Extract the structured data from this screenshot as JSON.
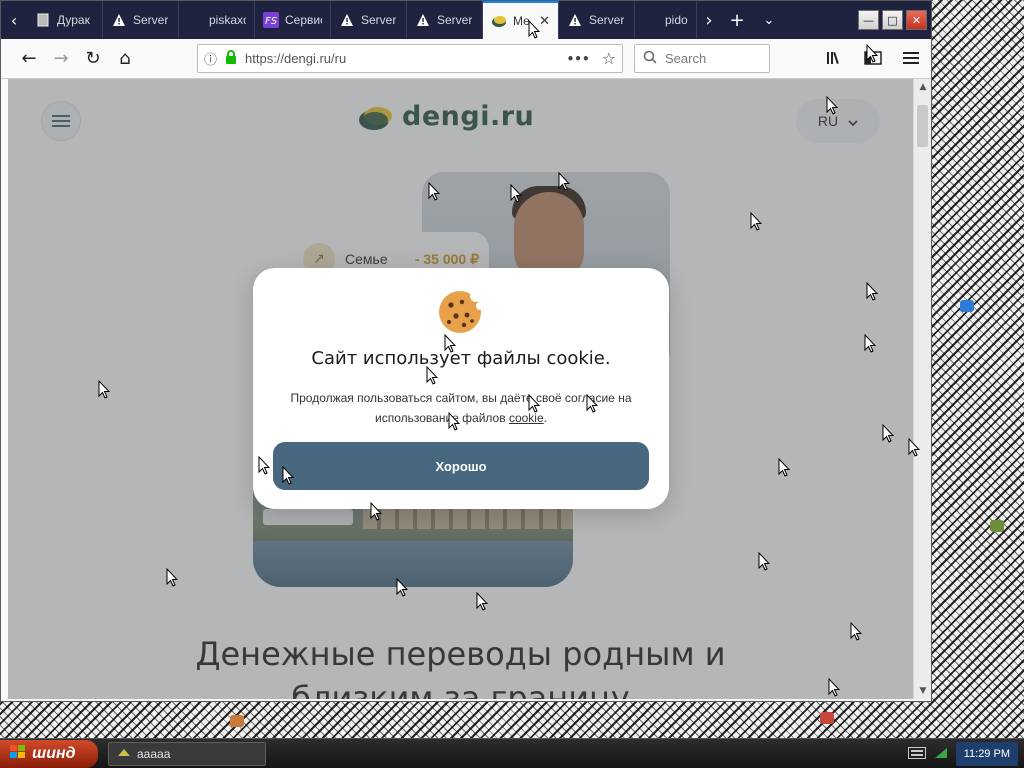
{
  "browser": {
    "tabs": [
      {
        "label": "Дурак",
        "icon": "page-icon"
      },
      {
        "label": "Server",
        "icon": "warning-icon"
      },
      {
        "label": "piskaxo",
        "icon": "blank-icon"
      },
      {
        "label": "Сервис",
        "icon": "fs-icon"
      },
      {
        "label": "Server",
        "icon": "warning-icon"
      },
      {
        "label": "Server",
        "icon": "warning-icon"
      },
      {
        "label": "Ме",
        "icon": "dengi-icon",
        "active": true
      },
      {
        "label": "Server",
        "icon": "warning-icon"
      },
      {
        "label": "pidor",
        "icon": "blank-icon"
      }
    ],
    "url": "https://dengi.ru/ru",
    "search_placeholder": "Search"
  },
  "site": {
    "logo_text": "dengi.ru",
    "language": "RU",
    "chip": {
      "label": "Семье",
      "amount": "- 35 000 ₽"
    },
    "hero_title_line1": "Денежные переводы родным и",
    "hero_title_line2": "близким за границу"
  },
  "cookie_modal": {
    "title": "Сайт использует файлы cookie.",
    "body_prefix": "Продолжая пользоваться сайтом, вы даёте своё согласие на использование файлов",
    "link_text": "cookie",
    "body_suffix": ".",
    "button_label": "Хорошо"
  },
  "taskbar": {
    "start_label": "шинд",
    "task_label": "ааааа",
    "clock": "11:29 PM"
  },
  "colors": {
    "accent": "#47687f",
    "logo_green": "#2f5a4b",
    "chip_amount": "#c49328",
    "tabbar": "#202340"
  }
}
